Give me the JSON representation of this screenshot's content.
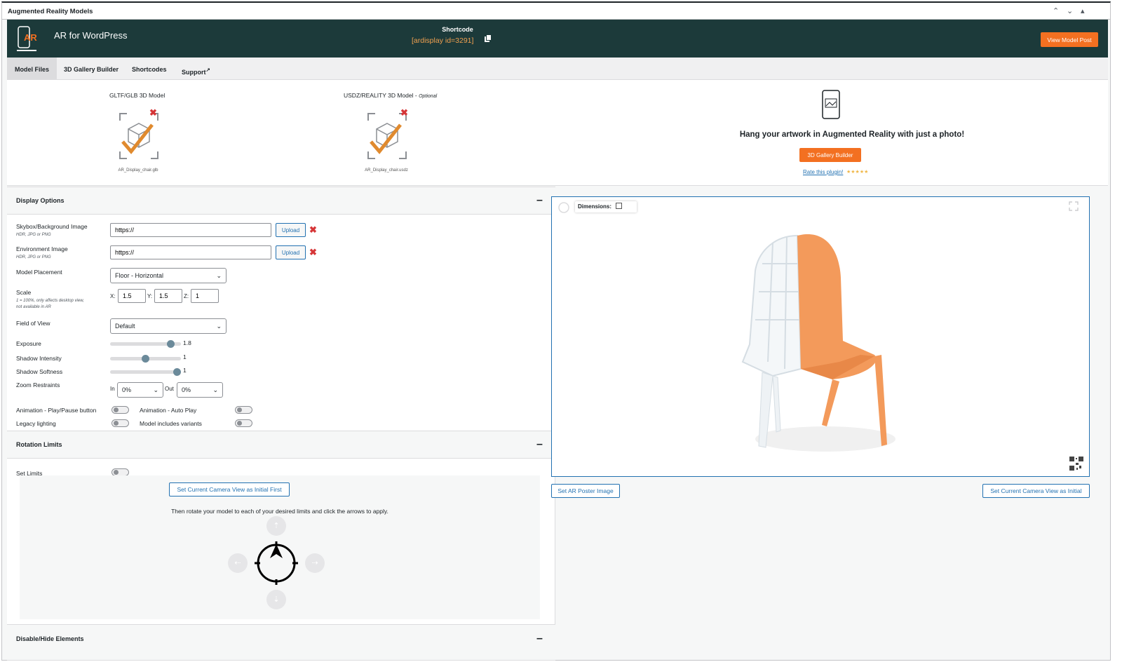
{
  "metabox": {
    "title": "Augmented Reality Models",
    "controls": [
      "⌃",
      "⌄",
      "▴"
    ]
  },
  "banner": {
    "app_title": "AR for WordPress",
    "logo_text": "AR",
    "shortcode_label": "Shortcode",
    "shortcode_value": "[ardisplay id=3291]",
    "view_post_label": "View Model Post",
    "colors": {
      "banner": "#1c3a3a",
      "accent": "#f37021",
      "shortcode": "#f0a050"
    }
  },
  "tabs": [
    {
      "label": "Model Files",
      "active": true
    },
    {
      "label": "3D Gallery Builder",
      "active": false
    },
    {
      "label": "Shortcodes",
      "active": false
    },
    {
      "label": "Support",
      "active": false,
      "external_icon": "↗"
    }
  ],
  "files": {
    "gltf": {
      "title": "GLTF/GLB 3D Model",
      "filename": "AR_Display_chair.glb",
      "icon": "model-check-icon"
    },
    "usdz": {
      "title": "USDZ/REALITY 3D Model - ",
      "optional": "Optional",
      "filename": "AR_Display_chair.usdz",
      "icon": "model-check-icon"
    },
    "remove_glyph": "✖",
    "artwork_text": "Hang your artwork in Augmented Reality with just a photo!",
    "gallery_button": "3D Gallery Builder",
    "rate_text": "Rate this plugin!",
    "stars": "★★★★★"
  },
  "display_options": {
    "title": "Display Options",
    "toggle": "–",
    "skybox": {
      "label": "Skybox/Background Image",
      "sub": "HDR, JPG or PNG",
      "value": "https://",
      "upload": "Upload"
    },
    "environment": {
      "label": "Environment Image",
      "sub": "HDR, JPG or PNG",
      "value": "https://",
      "upload": "Upload"
    },
    "placement": {
      "label": "Model Placement",
      "value": "Floor - Horizontal"
    },
    "scale": {
      "label": "Scale",
      "sub1": "1 = 100%, only affects desktop view,",
      "sub2": "not available in AR",
      "x_label": "X:",
      "y_label": "Y:",
      "z_label": "Z:",
      "x": "1.5",
      "y": "1.5",
      "z": "1"
    },
    "fov": {
      "label": "Field of View",
      "value": "Default"
    },
    "exposure": {
      "label": "Exposure",
      "value": "1.8",
      "level": 0.9
    },
    "shadow_intensity": {
      "label": "Shadow Intensity",
      "value": "1",
      "level": 0.5
    },
    "shadow_softness": {
      "label": "Shadow Softness",
      "value": "1",
      "level": 1.0
    },
    "zoom": {
      "label": "Zoom Restraints",
      "in_label": "In",
      "in_value": "0%",
      "out_label": "Out",
      "out_value": "0%"
    },
    "anim_play": "Animation - Play/Pause button",
    "anim_auto": "Animation - Auto Play",
    "legacy": "Legacy lighting",
    "variants": "Model includes variants"
  },
  "rotation": {
    "title": "Rotation Limits",
    "toggle": "–",
    "set_limits": "Set Limits",
    "initial_btn": "Set Current Camera View as Initial First",
    "instructions": "Then rotate your model to each of your desired limits and click the arrows to apply.",
    "arrows": {
      "up": "⇡",
      "down": "⇣",
      "left": "⇠",
      "right": "⇢"
    }
  },
  "disable_hide": {
    "title": "Disable/Hide Elements",
    "toggle": "–"
  },
  "viewer": {
    "dimensions_label": "Dimensions:",
    "poster_button": "Set AR Poster Image",
    "camera_button": "Set Current Camera View as Initial",
    "chair_colors": {
      "seat": "#f39a5b",
      "frame": "#e9eef2"
    }
  }
}
